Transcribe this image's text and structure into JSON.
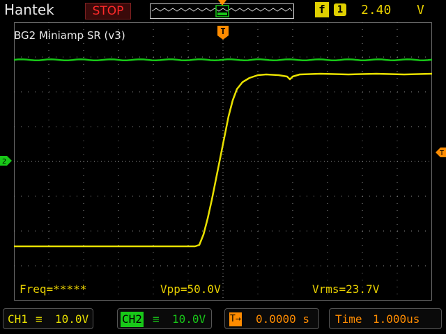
{
  "header": {
    "brand": "Hantek",
    "run_state": "STOP",
    "trigger": {
      "edge_glyph": "f",
      "source": "1",
      "level": "2.40",
      "unit": "V"
    }
  },
  "screen": {
    "title": "BG2 Miniamp SR (v3)",
    "trigger_marker_glyph": "T"
  },
  "measurements": {
    "freq": "Freq=*****",
    "vpp": "Vpp=50.0V",
    "vrms": "Vrms=23.7V"
  },
  "footer": {
    "ch1": {
      "label": "CH1",
      "coupling_glyph": "≡",
      "scale": "10.0V"
    },
    "ch2": {
      "label": "CH2",
      "coupling_glyph": "≡",
      "scale": "10.0V"
    },
    "trigger_pos": {
      "glyph": "T→",
      "value": "0.0000 s"
    },
    "time": {
      "label": "Time",
      "value": "1.000us"
    }
  },
  "colors": {
    "ch1": "#e8e000",
    "ch2": "#18c818",
    "trigger": "#ff8c00",
    "stop": "#ff2a2a"
  },
  "icons": {
    "trigger_marker": "trigger-position-icon",
    "ch2_marker": "channel-2-ground-marker-icon",
    "trigger_level_marker": "trigger-level-marker-icon"
  }
}
